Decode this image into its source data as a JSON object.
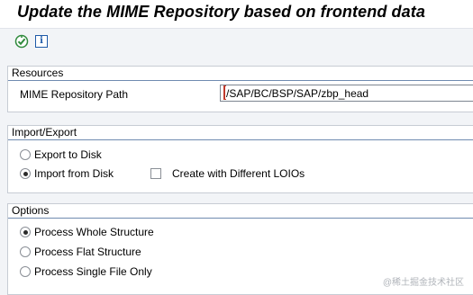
{
  "title": "Update the MIME Repository based on frontend data",
  "toolbar": {
    "execute_icon": "execute-icon",
    "info_icon": "info-icon",
    "info_glyph": "i"
  },
  "resources": {
    "header": "Resources",
    "path_label": "MIME Repository Path",
    "path_value": "/SAP/BC/BSP/SAP/zbp_head"
  },
  "import_export": {
    "header": "Import/Export",
    "export_label": "Export to Disk",
    "import_label": "Import from Disk",
    "different_loios_label": "Create with Different LOIOs",
    "selected": "import"
  },
  "options": {
    "header": "Options",
    "whole_label": "Process Whole Structure",
    "flat_label": "Process Flat Structure",
    "single_label": "Process Single File Only",
    "selected": "whole"
  },
  "watermark": "@稀土掘金技术社区",
  "colors": {
    "accent": "#1e5aa8",
    "execute": "#2f8a3c"
  }
}
